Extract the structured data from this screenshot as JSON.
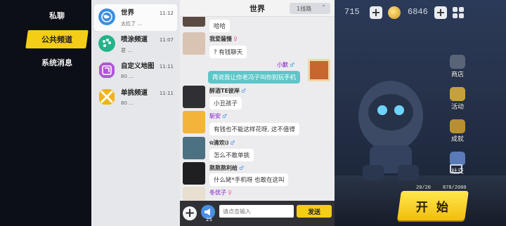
{
  "nav": {
    "items": [
      {
        "label": "私聊"
      },
      {
        "label": "公共频道"
      },
      {
        "label": "系统消息"
      }
    ]
  },
  "conversations": [
    {
      "name": "世界",
      "last": "太拉了 …",
      "time": "11:12",
      "icon": "globe-icon",
      "color": "#3b8ee0"
    },
    {
      "name": "喷涂频道",
      "last": "君 …",
      "time": "11:07",
      "icon": "palette-icon",
      "color": "#23b38a"
    },
    {
      "name": "自定义地图",
      "last": "80 …",
      "time": "11:11",
      "icon": "map-icon",
      "color": "#b157d8"
    },
    {
      "name": "单挑频道",
      "last": "80 …",
      "time": "11:11",
      "icon": "crossed-swords-icon",
      "color": "#f0b419"
    }
  ],
  "chat": {
    "title": "世界",
    "line": "1线路",
    "messages": [
      {
        "user": "",
        "text": "哈哈"
      },
      {
        "user": "我爱薩慢",
        "gender": "♀",
        "text": "? 有钱聊天"
      },
      {
        "user": "小默",
        "gender": "♂",
        "text": "再说我让你老冯子叫你别玩手机",
        "mine": true
      },
      {
        "user": "醉酒TE彼岸",
        "gender": "♂",
        "text": "小丑孩子"
      },
      {
        "user": "斩安",
        "gender": "♂",
        "text": "有钱也不能这样花呀, 这不值得"
      },
      {
        "user": "ଳ清欢ଓ",
        "gender": "♂",
        "text": "怎么不敢单挑"
      },
      {
        "user": "熬熬熬利给",
        "gender": "♂",
        "text": "什么姥*手机呀 也敢在这叫"
      },
      {
        "user": "冬优子",
        "gender": "♀",
        "text": ""
      }
    ],
    "input_placeholder": "请点击输入",
    "send_label": "发送",
    "horn_count": "25"
  },
  "game": {
    "currency1": "715",
    "currency2": "6846",
    "side_menu": [
      "商店",
      "活动",
      "成就",
      "社交"
    ],
    "start_label": "开 始",
    "progress_left": "20/20",
    "progress_right": "878/2000"
  },
  "colors": {
    "accent_yellow": "#f4cd16",
    "my_bubble": "#5cc6c8"
  }
}
